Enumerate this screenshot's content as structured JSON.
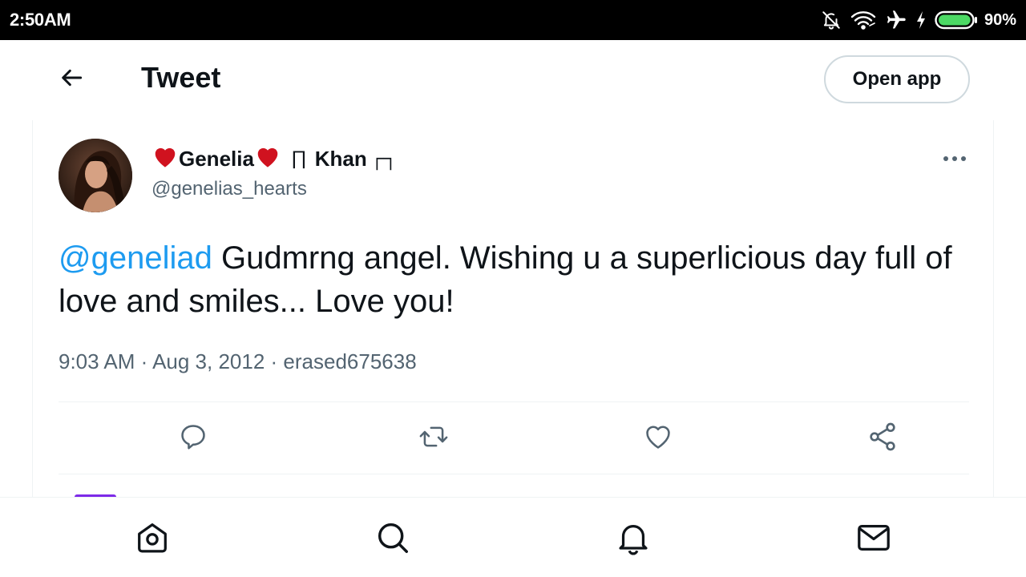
{
  "status_bar": {
    "time": "2:50AM",
    "battery_percent": "90%",
    "battery_level": 0.9,
    "icons": [
      "bell-off-icon",
      "wifi-icon",
      "airplane-icon",
      "charging-bolt-icon",
      "battery-icon"
    ]
  },
  "header": {
    "title": "Tweet",
    "open_app_label": "Open app",
    "back_icon": "back-arrow-icon"
  },
  "tweet": {
    "display_name_first": "Genelia",
    "display_name_sym1": "∏",
    "display_name_last": "Khan",
    "display_name_sym2": "┌┐",
    "handle": "@genelias_hearts",
    "mention": "@geneliad",
    "text": " Gudmrng angel. Wishing u a superlicious day full of love and smiles... Love you!",
    "meta": "9:03 AM · Aug 3, 2012 · erased675638",
    "actions": [
      "reply-icon",
      "retweet-icon",
      "like-icon",
      "share-icon"
    ],
    "name_heart_color": "#d0121f",
    "mention_color": "#1d9bf0"
  },
  "bottom_nav": {
    "items": [
      "home-icon",
      "search-icon",
      "notifications-bell-icon",
      "messages-envelope-icon"
    ]
  }
}
